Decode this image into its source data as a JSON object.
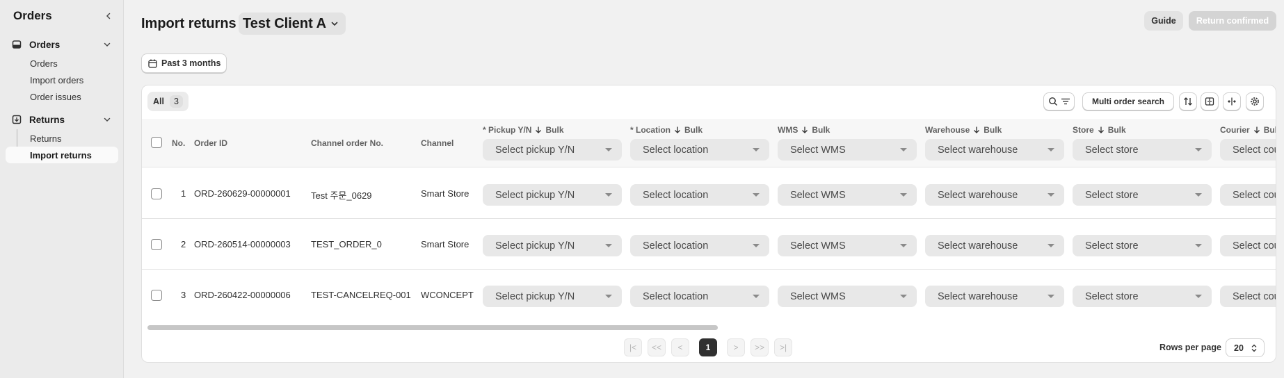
{
  "sidebar": {
    "title": "Orders",
    "groups": [
      {
        "label": "Orders",
        "items": [
          "Orders",
          "Import orders",
          "Order issues"
        ]
      },
      {
        "label": "Returns",
        "items": [
          "Returns",
          "Import returns"
        ]
      }
    ],
    "active_item": "Import returns"
  },
  "header": {
    "title": "Import returns",
    "client": "Test Client A",
    "guide_label": "Guide",
    "confirm_label": "Return confirmed"
  },
  "filter": {
    "date_range": "Past 3 months"
  },
  "table": {
    "tab_all_label": "All",
    "tab_all_count": "3",
    "multi_search_label": "Multi order search",
    "columns": {
      "no": "No.",
      "order_id": "Order ID",
      "channel_order_no": "Channel order No.",
      "channel": "Channel",
      "pickup": "* Pickup Y/N",
      "location": "* Location",
      "wms": "WMS",
      "warehouse": "Warehouse",
      "store": "Store",
      "courier": "Courier",
      "bulk": "Bulk"
    },
    "placeholders": {
      "pickup": "Select pickup Y/N",
      "location": "Select location",
      "wms": "Select WMS",
      "warehouse": "Select warehouse",
      "store": "Select store",
      "courier": "Select courier"
    },
    "rows": [
      {
        "no": "1",
        "order_id": "ORD-260629-00000001",
        "channel_order_no": "Test 주문_0629",
        "channel": "Smart Store"
      },
      {
        "no": "2",
        "order_id": "ORD-260514-00000003",
        "channel_order_no": "TEST_ORDER_0",
        "channel": "Smart Store"
      },
      {
        "no": "3",
        "order_id": "ORD-260422-00000006",
        "channel_order_no": "TEST-CANCELREQ-001",
        "channel": "WCONCEPT"
      }
    ]
  },
  "pagination": {
    "first": "|<",
    "prev_many": "<<",
    "prev": "<",
    "current_page": "1",
    "next": ">",
    "next_many": ">>",
    "last": ">|",
    "rows_per_page_label": "Rows per page",
    "rows_per_page": "20"
  },
  "colors": {
    "accent_dark": "#303030",
    "disabled_button": "#d4d4d4",
    "sidebar_bg": "#ebebeb"
  }
}
